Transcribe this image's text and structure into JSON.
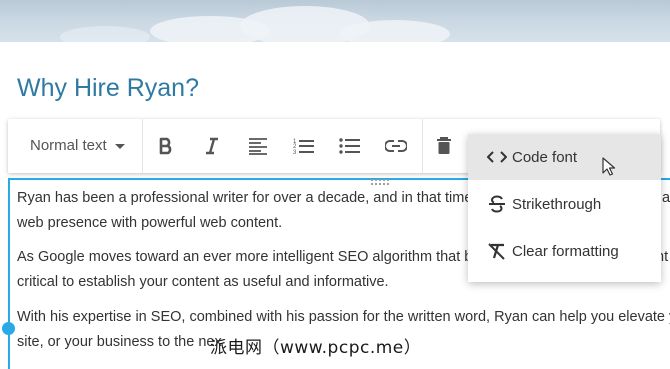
{
  "page": {
    "title": "Why Hire Ryan?"
  },
  "toolbar": {
    "text_style": "Normal text",
    "buttons": [
      "bold-icon",
      "italic-icon",
      "align-left-icon",
      "numbered-list-icon",
      "bulleted-list-icon",
      "link-icon",
      "trash-icon"
    ]
  },
  "format_menu": {
    "items": [
      {
        "label": "Code font",
        "icon": "code-icon",
        "hovered": true
      },
      {
        "label": "Strikethrough",
        "icon": "strikethrough-icon",
        "hovered": false
      },
      {
        "label": "Clear formatting",
        "icon": "clear-formatting-icon",
        "hovered": false
      }
    ]
  },
  "editor": {
    "paragraphs": [
      {
        "line1": "Ryan has been a professional writer for over a decade, and in that time he",
        "line2": "web presence with powerful web content."
      },
      {
        "line1": "As Google moves toward an ever more intelligent SEO algorithm that be",
        "line2": "critical to establish your content as useful and informative."
      },
      {
        "line1": "With his expertise in SEO, combined with his passion for the written word, Ryan can help you elevate your",
        "line2": "site, or your business to the nex"
      }
    ],
    "right_clipped": [
      "a",
      "nt"
    ]
  },
  "watermark": "派电网（www.pcpc.me）",
  "colors": {
    "title": "#2f7aa3",
    "accent": "#29a9e6",
    "menu_hover": "#e6e6e6"
  }
}
